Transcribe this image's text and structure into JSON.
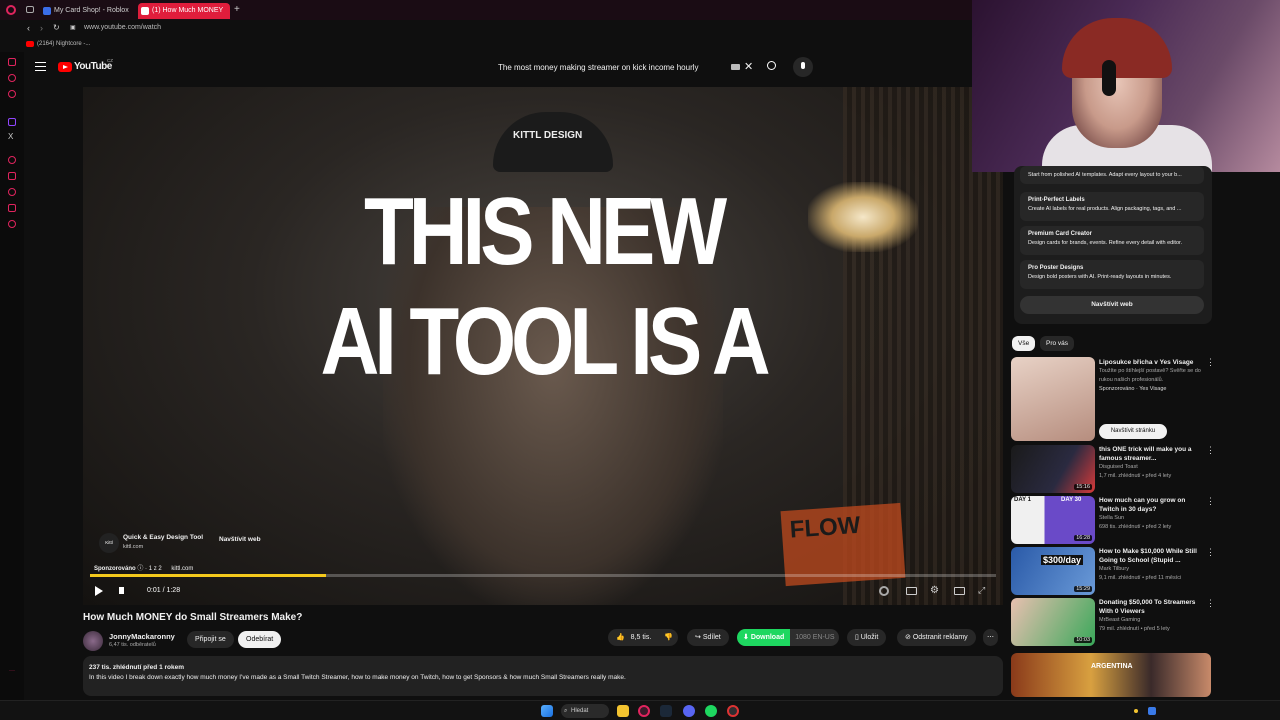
{
  "browser": {
    "tabs": [
      {
        "label": "My Card Shop! - Roblox"
      },
      {
        "label": "(1) How Much MONEY do"
      }
    ],
    "url": "www.youtube.com/watch",
    "bookmark": "(2164) Nightcore -..."
  },
  "header": {
    "logo_text": "YouTube",
    "region": "CZ",
    "search_query": "The most money making streamer on kick income hourly"
  },
  "video": {
    "headline_line1": "THIS NEW",
    "headline_line2": "AI TOOL IS A",
    "ad": {
      "title": "Quick & Easy Design Tool",
      "domain": "kittl.com",
      "cta": "Navštívit web",
      "logo": "Kittl",
      "sponsor_label": "Sponzorováno",
      "sponsor_count": "1 z 2",
      "sponsor_domain": "kittl.com"
    },
    "time": "0:01 / 1:28",
    "progress": 0.26,
    "cap_text": "KITTL DESIGN",
    "sign_text": "FLOW"
  },
  "watch": {
    "title": "How Much MONEY do Small Streamers Make?",
    "channel": "JonnyMackaronny",
    "subscribers": "6,47 tis. odběratelů",
    "join": "Připojit se",
    "subscribe": "Odebírat",
    "likes": "8,5 tis.",
    "share": "Sdílet",
    "download": "Download",
    "quality": "1080 EN-US",
    "save": "Uložit",
    "remove_ads": "Odstranit reklamy",
    "views_date": "237 tis. zhlédnutí  před 1 rokem",
    "description": "In this video I break down exactly how much money I've made as a Small Twitch Streamer, how to make money on Twitch, how to get Sponsors & how much Small Streamers really make."
  },
  "sidebar": {
    "ad_options": [
      {
        "title": "",
        "desc": "Start from polished AI templates. Adapt every layout to your b..."
      },
      {
        "title": "Print-Perfect Labels",
        "desc": "Create AI labels for real products. Align packaging, tags, and ..."
      },
      {
        "title": "Premium Card Creator",
        "desc": "Design cards for brands, events. Refine every detail with editor."
      },
      {
        "title": "Pro Poster Designs",
        "desc": "Design bold posters with AI. Print-ready layouts in minutes."
      }
    ],
    "ad_cta": "Navštívit web",
    "chips": [
      "Vše",
      "Pro vás"
    ],
    "recommendations": [
      {
        "title": "Liposukce břicha v Yes Visage",
        "sub1": "Toužíte po štíhlejší postavě? Svěřte se do rukou našich profesionálů.",
        "sub2": "Sponzorováno · Yes Visage",
        "cta": "Navštívit stránku",
        "duration": ""
      },
      {
        "title": "this ONE trick will make you a famous streamer...",
        "sub1": "Disguised Toast",
        "sub2": "1,7 mil. zhlédnutí • před 4 lety",
        "cta": "",
        "duration": "15:16"
      },
      {
        "title": "How much can you grow on Twitch in 30 days?",
        "sub1": "Stella Sun",
        "sub2": "698 tis. zhlédnutí • před 2 lety",
        "cta": "",
        "duration": "16:28"
      },
      {
        "title": "How to Make $10,000 While Still Going to School (Stupid ...",
        "sub1": "Mark Tilbury",
        "sub2": "9,1 mil. zhlédnutí • před 11 měsíci",
        "cta": "",
        "duration": "15:29"
      },
      {
        "title": "Donating $50,000 To Streamers With 0 Viewers",
        "sub1": "MrBeast Gaming",
        "sub2": "79 mil. zhlédnutí • před 5 lety",
        "cta": "",
        "duration": "10:03"
      }
    ],
    "thumb_texts": [
      "DAY 1",
      "DAY 30",
      "$300/day",
      "ARGENTINA"
    ]
  },
  "taskbar": {
    "search_label": "Hledat"
  },
  "colors": {
    "accent_red": "#ff0000",
    "progress_yellow": "#f4c91c",
    "download_green": "#1ed760",
    "browser_accent": "#e0245e"
  }
}
